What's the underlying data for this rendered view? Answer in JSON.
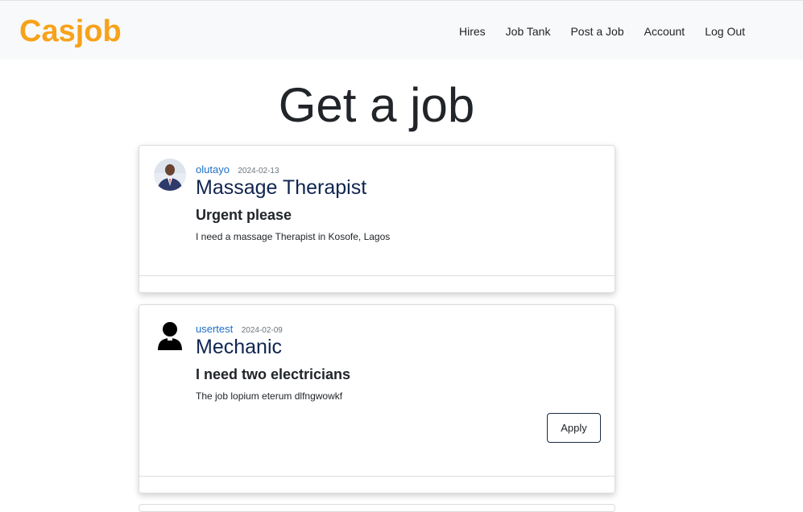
{
  "brand": {
    "name": "Casjob",
    "color": "#f7a21b"
  },
  "nav": {
    "items": [
      {
        "label": "Hires"
      },
      {
        "label": "Job Tank"
      },
      {
        "label": "Post a Job"
      },
      {
        "label": "Account"
      },
      {
        "label": "Log Out"
      }
    ]
  },
  "main": {
    "title": "Get a job",
    "jobs": [
      {
        "username": "olutayo",
        "date": "2024-02-13",
        "title": "Massage Therapist",
        "subtitle": "Urgent please",
        "description": "I need a massage Therapist in Kosofe, Lagos",
        "avatar_icon": "user-photo-avatar"
      },
      {
        "username": "usertest",
        "date": "2024-02-09",
        "title": "Mechanic",
        "subtitle": "I need two electricians",
        "description": "The job lopium eterum dlfngwowkf",
        "avatar_icon": "default-user-avatar-icon",
        "apply_label": "Apply"
      }
    ]
  }
}
